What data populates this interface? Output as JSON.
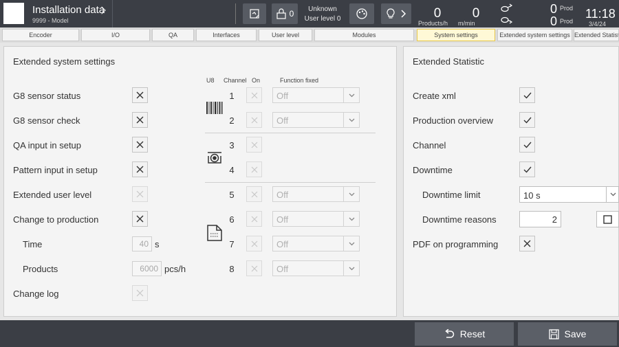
{
  "header": {
    "title": "Installation data",
    "subtitle": "9999 - Model",
    "lock_count": "0",
    "user_name": "Unknown",
    "user_level": "User level 0",
    "products_rate": "0",
    "products_rate_unit": "Products/h",
    "speed": "0",
    "speed_unit": "m/min",
    "prod_count_1": "0",
    "prod_label_1": "Prod",
    "prod_count_2": "0",
    "prod_label_2": "Prod",
    "time": "11:18",
    "date": "3/4/24"
  },
  "tabs": [
    {
      "label": "Encoder"
    },
    {
      "label": "I/O"
    },
    {
      "label": "QA"
    },
    {
      "label": "Interfaces"
    },
    {
      "label": "User level"
    },
    {
      "label": "Modules"
    },
    {
      "label": "System settings"
    },
    {
      "label": "Extended system settings"
    },
    {
      "label": "Extended Statistic"
    }
  ],
  "left": {
    "title": "Extended system settings",
    "rows": [
      {
        "label": "G8 sensor status",
        "checked": true,
        "enabled": true
      },
      {
        "label": "G8 sensor check",
        "checked": true,
        "enabled": true
      },
      {
        "label": "QA input in setup",
        "checked": true,
        "enabled": true
      },
      {
        "label": "Pattern input in setup",
        "checked": true,
        "enabled": true
      },
      {
        "label": "Extended user level",
        "checked": true,
        "enabled": false
      },
      {
        "label": "Change to production",
        "checked": true,
        "enabled": true
      },
      {
        "label": "Time",
        "value": "40",
        "unit": "s"
      },
      {
        "label": "Products",
        "value": "6000",
        "unit": "pcs/h"
      },
      {
        "label": "Change log",
        "checked": true,
        "enabled": false
      }
    ]
  },
  "channels": {
    "headers": {
      "u8": "U8",
      "channel": "Channel",
      "on": "On",
      "function": "Function fixed"
    },
    "rows": [
      {
        "num": "1",
        "value": "Off"
      },
      {
        "num": "2",
        "value": "Off"
      },
      {
        "num": "3",
        "value": ""
      },
      {
        "num": "4",
        "value": ""
      },
      {
        "num": "5",
        "value": "Off"
      },
      {
        "num": "6",
        "value": "Off"
      },
      {
        "num": "7",
        "value": "Off"
      },
      {
        "num": "8",
        "value": "Off"
      }
    ],
    "group_icons": [
      "barcode-icon",
      "camera-icon",
      "document-icon"
    ]
  },
  "right": {
    "title": "Extended Statistic",
    "create_xml": "Create xml",
    "production_overview": "Production overview",
    "channel": "Channel",
    "downtime": "Downtime",
    "downtime_limit_label": "Downtime limit",
    "downtime_limit_value": "10 s",
    "downtime_reasons_label": "Downtime reasons",
    "downtime_reasons_value": "2",
    "pdf_label": "PDF on programming"
  },
  "footer": {
    "reset_label": "Reset",
    "save_label": "Save"
  },
  "colors": {
    "topbar": "#3b3e45",
    "active_tab": "#fff9d6",
    "panel": "#f4f4f4"
  }
}
